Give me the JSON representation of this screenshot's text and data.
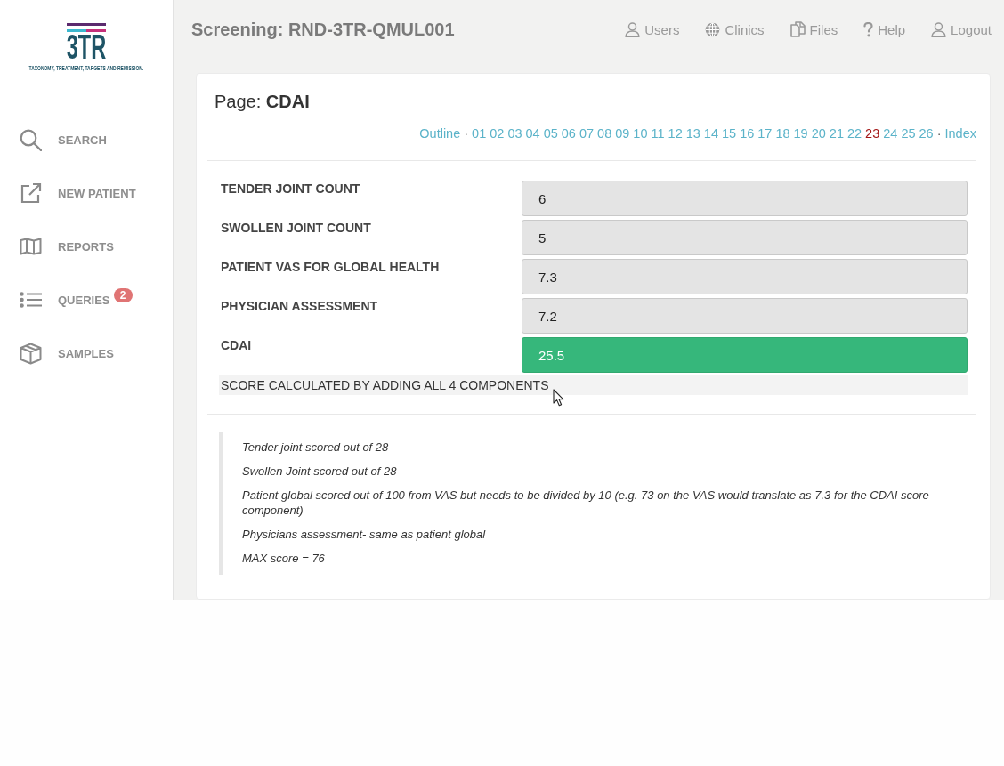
{
  "sidebar": {
    "logo": {
      "mark": "3TR",
      "tagline": "TAXONOMY, TREATMENT, TARGETS AND REMISSION."
    },
    "items": [
      {
        "label": "SEARCH"
      },
      {
        "label": "NEW PATIENT"
      },
      {
        "label": "REPORTS"
      },
      {
        "label": "QUERIES",
        "badge": "2"
      },
      {
        "label": "SAMPLES"
      }
    ]
  },
  "header": {
    "title": "Screening: RND-3TR-QMUL001",
    "nav": [
      {
        "label": "Users"
      },
      {
        "label": "Clinics"
      },
      {
        "label": "Files"
      },
      {
        "label": "Help"
      },
      {
        "label": "Logout"
      }
    ]
  },
  "page": {
    "title": "Page: **CDAI**",
    "pager": {
      "outline": "Outline",
      "separator_before": "·",
      "pages": [
        {
          "label": "01",
          "selected": false
        },
        {
          "label": "02",
          "selected": false
        },
        {
          "label": "03",
          "selected": false
        },
        {
          "label": "04",
          "selected": false
        },
        {
          "label": "05",
          "selected": false
        },
        {
          "label": "06",
          "selected": false
        },
        {
          "label": "07",
          "selected": false
        },
        {
          "label": "08",
          "selected": false
        },
        {
          "label": "09",
          "selected": false
        },
        {
          "label": "10",
          "selected": false
        },
        {
          "label": "11",
          "selected": false
        },
        {
          "label": "12",
          "selected": false
        },
        {
          "label": "13",
          "selected": false
        },
        {
          "label": "14",
          "selected": false
        },
        {
          "label": "15",
          "selected": false
        },
        {
          "label": "16",
          "selected": false
        },
        {
          "label": "17",
          "selected": false
        },
        {
          "label": "18",
          "selected": false
        },
        {
          "label": "19",
          "selected": false
        },
        {
          "label": "20",
          "selected": false
        },
        {
          "label": "21",
          "selected": false
        },
        {
          "label": "22",
          "selected": false
        },
        {
          "label": "23",
          "selected": true
        },
        {
          "label": "24",
          "selected": false
        },
        {
          "label": "25",
          "selected": false
        },
        {
          "label": "26",
          "selected": false
        }
      ],
      "separator_after": "·",
      "index": "Index"
    },
    "fields": [
      {
        "label": "TENDER JOINT COUNT",
        "value": "6",
        "kind": "input"
      },
      {
        "label": "SWOLLEN JOINT COUNT",
        "value": "5",
        "kind": "input"
      },
      {
        "label": "PATIENT VAS FOR GLOBAL HEALTH",
        "value": "7.3",
        "kind": "input"
      },
      {
        "label": "PHYSICIAN ASSESSMENT",
        "value": "7.2",
        "kind": "input"
      },
      {
        "label": "CDAI",
        "value": "25.5",
        "kind": "result"
      }
    ],
    "score_note": "SCORE CALCULATED BY ADDING ALL 4 COMPONENTS",
    "notes": [
      "Tender joint scored out of 28",
      "Swollen Joint scored out of 28",
      "Patient global scored out of 100 from VAS but needs to be divided by 10 (e.g. 73 on the VAS would translate as 7.3 for the CDAI score component)",
      "Physicians assessment- same as patient global",
      "MAX score = 76"
    ]
  }
}
